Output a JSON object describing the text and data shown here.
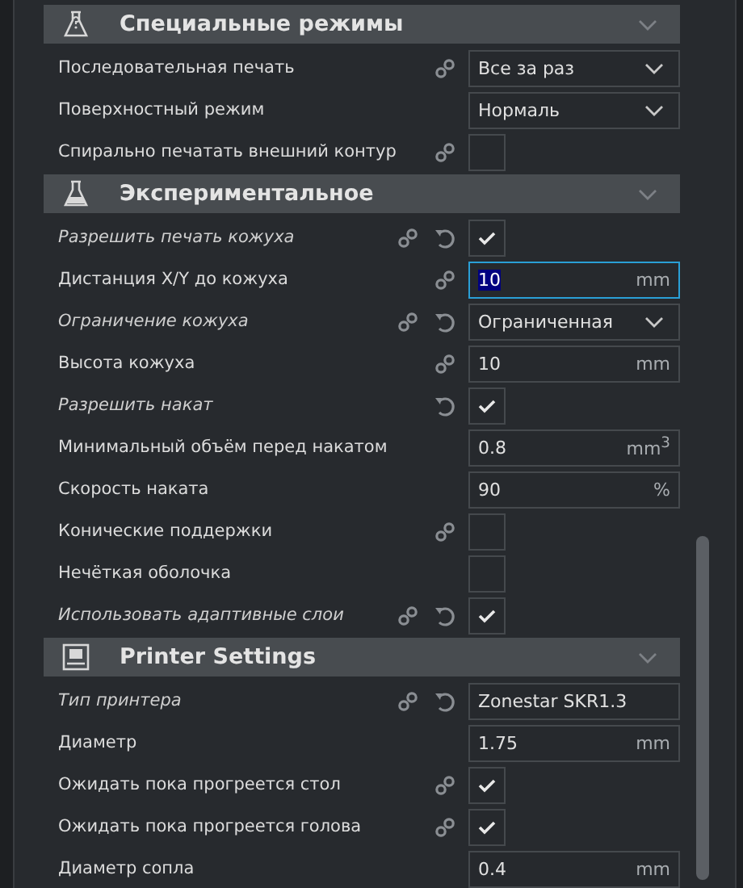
{
  "sections": [
    {
      "title": "Специальные режимы",
      "rows": [
        {
          "label": "Последовательная печать",
          "modified": false,
          "link": true,
          "reset": false,
          "kind": "dropdown",
          "value": "Все за раз"
        },
        {
          "label": "Поверхностный режим",
          "modified": false,
          "link": false,
          "reset": false,
          "kind": "dropdown",
          "value": "Нормаль"
        },
        {
          "label": "Спирально печатать внешний контур",
          "modified": false,
          "link": true,
          "reset": false,
          "kind": "checkbox",
          "checked": false
        }
      ]
    },
    {
      "title": "Экспериментальное",
      "rows": [
        {
          "label": "Разрешить печать кожуха",
          "modified": true,
          "link": true,
          "reset": true,
          "kind": "checkbox",
          "checked": true
        },
        {
          "label": "Дистанция X/Y до кожуха",
          "modified": false,
          "link": true,
          "reset": false,
          "kind": "number",
          "value": "10",
          "unit": "mm",
          "focused": true
        },
        {
          "label": "Ограничение кожуха",
          "modified": true,
          "link": true,
          "reset": true,
          "kind": "dropdown",
          "value": "Ограниченная"
        },
        {
          "label": "Высота кожуха",
          "modified": false,
          "link": true,
          "reset": false,
          "kind": "number",
          "value": "10",
          "unit": "mm",
          "focused": false
        },
        {
          "label": "Разрешить накат",
          "modified": true,
          "link": false,
          "reset": true,
          "kind": "checkbox",
          "checked": true
        },
        {
          "label": "Минимальный объём перед накатом",
          "modified": false,
          "link": false,
          "reset": false,
          "kind": "number",
          "value": "0.8",
          "unit": "mm$^{3}$",
          "focused": false
        },
        {
          "label": "Скорость наката",
          "modified": false,
          "link": false,
          "reset": false,
          "kind": "number",
          "value": "90",
          "unit": "%",
          "focused": false
        },
        {
          "label": "Конические поддержки",
          "modified": false,
          "link": true,
          "reset": false,
          "kind": "checkbox",
          "checked": false
        },
        {
          "label": "Нечёткая оболочка",
          "modified": false,
          "link": false,
          "reset": false,
          "kind": "checkbox",
          "checked": false
        },
        {
          "label": "Использовать адаптивные слои",
          "modified": true,
          "link": true,
          "reset": true,
          "kind": "checkbox",
          "checked": true
        }
      ]
    },
    {
      "title": "Printer Settings",
      "rows": [
        {
          "label": "Тип принтера",
          "modified": true,
          "link": true,
          "reset": true,
          "kind": "text",
          "value": "Zonestar SKR1.3"
        },
        {
          "label": "Диаметр",
          "modified": false,
          "link": false,
          "reset": false,
          "kind": "number",
          "value": "1.75",
          "unit": "mm",
          "focused": false
        },
        {
          "label": "Ожидать пока прогреется стол",
          "modified": false,
          "link": true,
          "reset": false,
          "kind": "checkbox",
          "checked": true
        },
        {
          "label": "Ожидать пока прогреется голова",
          "modified": false,
          "link": true,
          "reset": false,
          "kind": "checkbox",
          "checked": true
        },
        {
          "label": "Диаметр сопла",
          "modified": false,
          "link": false,
          "reset": false,
          "kind": "number",
          "value": "0.4",
          "unit": "mm",
          "focused": false
        }
      ]
    }
  ]
}
